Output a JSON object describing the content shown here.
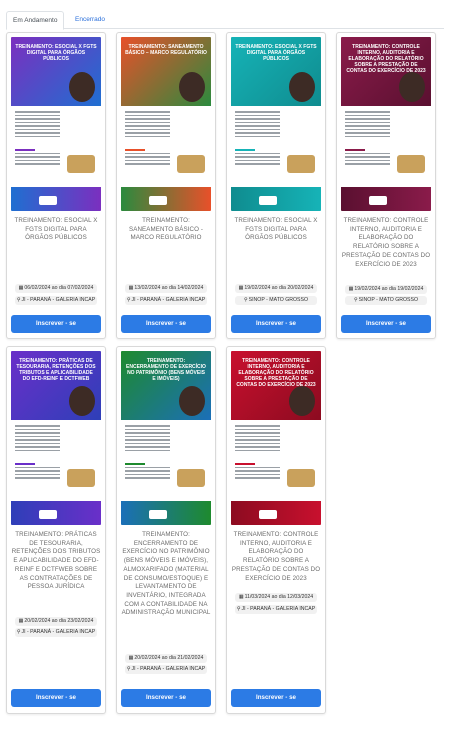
{
  "tabs": [
    {
      "label": "Em Andamento"
    },
    {
      "label": "Encerrado"
    }
  ],
  "courses": [
    {
      "poster_title": "TREINAMENTO: ESOCIAL X FGTS DIGITAL PARA ÓRGÃOS PÚBLICOS",
      "title": "TREINAMENTO: ESOCIAL X FGTS DIGITAL PARA ÓRGÃOS PÚBLICOS",
      "dates": "06/02/2024 ao dia 07/02/2024",
      "location": "JI - PARANÁ - GALERIA INCAP",
      "button": "Inscrever - se",
      "colors": [
        "#7b2fbf",
        "#1f6fd1"
      ]
    },
    {
      "poster_title": "TREINAMENTO: SANEAMENTO BÁSICO – MARCO REGULATÓRIO",
      "title": "TREINAMENTO: SANEAMENTO BÁSICO - MARCO REGULATÓRIO",
      "dates": "13/02/2024 ao dia 14/02/2024",
      "location": "JI - PARANÁ - GALERIA INCAP",
      "button": "Inscrever - se",
      "colors": [
        "#e8502a",
        "#2b8a3e"
      ]
    },
    {
      "poster_title": "TREINAMENTO: ESOCIAL X FGTS DIGITAL PARA ÓRGÃOS PÚBLICOS",
      "title": "TREINAMENTO: ESOCIAL X FGTS DIGITAL PARA ÓRGÃOS PÚBLICOS",
      "dates": "19/02/2024 ao dia 20/02/2024",
      "location": "SINOP - MATO GROSSO",
      "button": "Inscrever - se",
      "colors": [
        "#16b3b7",
        "#0f8c8f"
      ]
    },
    {
      "poster_title": "TREINAMENTO: CONTROLE INTERNO, AUDITORIA E ELABORAÇÃO DO RELATÓRIO SOBRE A PRESTAÇÃO DE CONTAS DO EXERCÍCIO DE 2023",
      "title": "TREINAMENTO: CONTROLE INTERNO, AUDITORIA E ELABORAÇÃO DO RELATÓRIO SOBRE A PRESTAÇÃO DE CONTAS DO EXERCÍCIO DE 2023",
      "dates": "19/02/2024 ao dia 19/02/2024",
      "location": "SINOP - MATO GROSSO",
      "button": "Inscrever - se",
      "colors": [
        "#8a1b4a",
        "#5a1030"
      ]
    },
    {
      "poster_title": "TREINAMENTO: PRÁTICAS DE TESOURARIA, RETENÇÕES DOS TRIBUTOS E APLICABILIDADE DO EFD-REINF E DCTFWEB",
      "title": "TREINAMENTO: PRÁTICAS DE TESOURARIA, RETENÇÕES DOS TRIBUTOS E APLICABILIDADE DO EFD-REINF E DCTFWEB SOBRE AS CONTRATAÇÕES DE PESSOA JURÍDICA",
      "dates": "20/02/2024 ao dia 23/02/2024",
      "location": "JI - PARANÁ - GALERIA INCAP",
      "button": "Inscrever - se",
      "colors": [
        "#6a2fc9",
        "#2e3fb8"
      ]
    },
    {
      "poster_title": "TREINAMENTO: ENCERRAMENTO DE EXERCÍCIO NO PATRIMÔNIO (BENS MÓVEIS E IMÓVEIS)",
      "title": "TREINAMENTO: ENCERRAMENTO DE EXERCÍCIO NO PATRIMÔNIO (BENS MÓVEIS E IMÓVEIS), ALMOXARIFADO (MATERIAL DE CONSUMO/ESTOQUE) E LEVANTAMENTO DE INVENTÁRIO, INTEGRADA COM A CONTABILIDADE NA ADMINISTRAÇÃO MUNICIPAL",
      "dates": "20/02/2024 ao dia 21/02/2024",
      "location": "JI - PARANÁ - GALERIA INCAP",
      "button": "Inscrever - se",
      "colors": [
        "#1e8a2e",
        "#1b6fb8"
      ]
    },
    {
      "poster_title": "TREINAMENTO: CONTROLE INTERNO, AUDITORIA E ELABORAÇÃO DO RELATÓRIO SOBRE A PRESTAÇÃO DE CONTAS DO EXERCÍCIO DE 2023",
      "title": "TREINAMENTO: CONTROLE INTERNO, AUDITORIA E ELABORAÇÃO DO RELATÓRIO SOBRE A PRESTAÇÃO DE CONTAS DO EXERCÍCIO DE 2023",
      "dates": "11/03/2024 ao dia 12/03/2024",
      "location": "JI - PARANÁ - GALERIA INCAP",
      "button": "Inscrever - se",
      "colors": [
        "#c8102e",
        "#8c0b20"
      ]
    }
  ]
}
